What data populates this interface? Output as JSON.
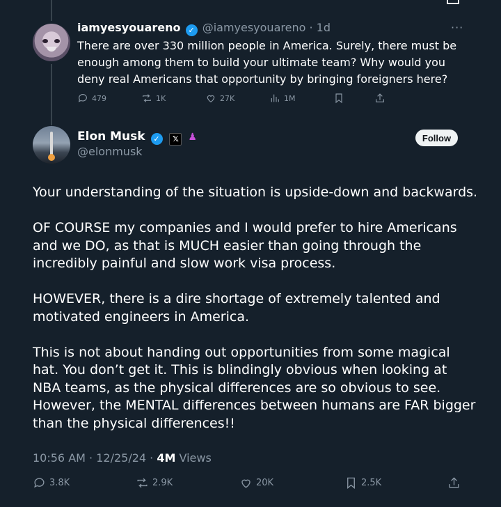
{
  "reply": {
    "name": "iamyesyouareno",
    "handle_time": "@iamyesyouareno · 1d",
    "more": "···",
    "text": "There are over 330 million people in America. Surely, there must be enough among them to build your ultimate team? Why would you deny real Americans that opportunity by bringing foreigners here?",
    "stats": {
      "replies": "479",
      "reposts": "1K",
      "likes": "27K",
      "views": "1M"
    }
  },
  "main": {
    "name": "Elon Musk",
    "handle": "@elonmusk",
    "follow_label": "Follow",
    "x_badge": "𝕏",
    "paragraphs": [
      "Your understanding of the situation is upside-down and backwards.",
      "OF COURSE my companies and I would prefer to hire Americans and we DO, as that is MUCH easier than going through the incredibly painful and slow work visa process.",
      "HOWEVER, there is a dire shortage of extremely talented and motivated engineers in America.",
      "This is not about handing out opportunities from some magical hat. You don’t get it. This is blindingly obvious when looking at NBA teams, as the physical differences are so obvious to see. However, the MENTAL differences between humans are FAR bigger than the physical differences!!"
    ],
    "timestamp": "10:56 AM · 12/25/24 · ",
    "views_count": "4M",
    "views_label": " Views",
    "stats": {
      "replies": "3.8K",
      "reposts": "2.9K",
      "likes": "20K",
      "bookmarks": "2.5K"
    }
  },
  "colors": {
    "background": "#15202b",
    "muted": "#8b98a5",
    "verified": "#1d9bf0"
  },
  "icons": [
    "reply-icon",
    "repost-icon",
    "like-icon",
    "views-icon",
    "bookmark-icon",
    "share-icon",
    "verified-icon",
    "more-icon"
  ]
}
